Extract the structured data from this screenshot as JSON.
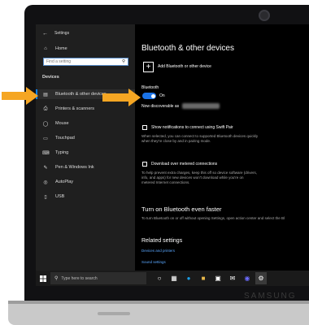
{
  "device": {
    "brand": "SAMSUNG"
  },
  "sidebar": {
    "title": "Settings",
    "search_placeholder": "Find a setting",
    "section": "Devices",
    "items": [
      {
        "label": "Home",
        "icon": "home-icon"
      },
      {
        "label": "Bluetooth & other devices",
        "icon": "bluetooth-devices-icon"
      },
      {
        "label": "Printers & scanners",
        "icon": "printer-icon"
      },
      {
        "label": "Mouse",
        "icon": "mouse-icon"
      },
      {
        "label": "Touchpad",
        "icon": "touchpad-icon"
      },
      {
        "label": "Typing",
        "icon": "keyboard-icon"
      },
      {
        "label": "Pen & Windows Ink",
        "icon": "pen-icon"
      },
      {
        "label": "AutoPlay",
        "icon": "autoplay-icon"
      },
      {
        "label": "USB",
        "icon": "usb-icon"
      }
    ]
  },
  "content": {
    "title": "Bluetooth & other devices",
    "add_device": "Add Bluetooth or other device",
    "bluetooth_label": "Bluetooth",
    "bluetooth_state": "On",
    "discoverable": "Now discoverable as",
    "swift_pair_label": "Show notifications to connect using Swift Pair",
    "swift_pair_desc_1": "When selected, you can connect to supported Bluetooth devices quickly",
    "swift_pair_desc_2": "when they're close by and in pairing mode.",
    "metered_label": "Download over metered connections",
    "metered_desc_1": "To help prevent extra charges, keep this off so device software (drivers,",
    "metered_desc_2": "info, and apps) for new devices won't download while you're on",
    "metered_desc_3": "metered Internet connections.",
    "faster_title": "Turn on Bluetooth even faster",
    "faster_desc": "To turn Bluetooth on or off without opening Settings, open action center and select the Bl",
    "related_title": "Related settings",
    "related_link_1": "Devices and printers",
    "related_link_2": "Sound settings"
  },
  "taskbar": {
    "search_placeholder": "Type here to search"
  },
  "colors": {
    "accent": "#1a73e8",
    "callout_arrow": "#f5a623",
    "link": "#5aa7ff"
  }
}
